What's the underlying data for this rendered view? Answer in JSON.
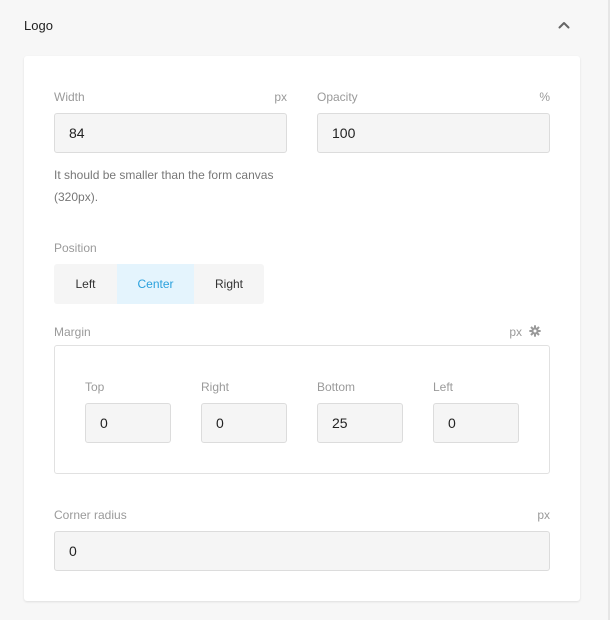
{
  "section": {
    "title": "Logo",
    "collapse_icon": "chevron-up-icon"
  },
  "width_field": {
    "label": "Width",
    "unit": "px",
    "value": "84",
    "hint": "It should be smaller than the form canvas (320px)."
  },
  "opacity_field": {
    "label": "Opacity",
    "unit": "%",
    "value": "100"
  },
  "position": {
    "label": "Position",
    "options": [
      "Left",
      "Center",
      "Right"
    ],
    "selected": "Center"
  },
  "margin": {
    "label": "Margin",
    "unit": "px",
    "settings_icon": "gear-icon",
    "top": {
      "label": "Top",
      "value": "0"
    },
    "right": {
      "label": "Right",
      "value": "0"
    },
    "bottom": {
      "label": "Bottom",
      "value": "25"
    },
    "left": {
      "label": "Left",
      "value": "0"
    }
  },
  "corner_radius": {
    "label": "Corner radius",
    "unit": "px",
    "value": "0"
  },
  "colors": {
    "page_bg": "#f7f7f7",
    "card_bg": "#ffffff",
    "input_bg": "#f5f5f5",
    "accent": "#2aa1dd",
    "accent_bg": "#e4f4fd",
    "muted_text": "#9a9a9a"
  }
}
